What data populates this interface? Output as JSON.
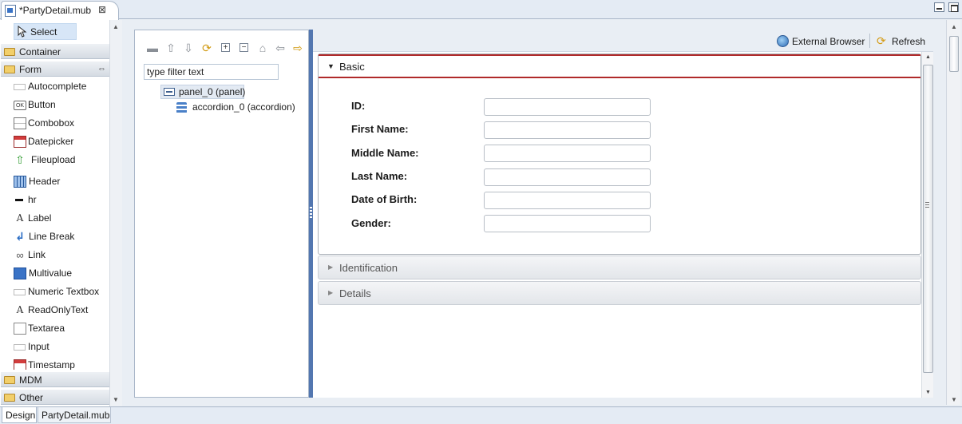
{
  "editor_tab": {
    "title": "*PartyDetail.mub",
    "close_glyph": "⊠",
    "icon": "mub-file-icon"
  },
  "palette": {
    "select_label": "Select",
    "drawers": {
      "container": "Container",
      "form": "Form",
      "mdm": "MDM",
      "other": "Other"
    },
    "form_items": [
      {
        "label": "Autocomplete",
        "icon": "input-box-icon"
      },
      {
        "label": "Button",
        "icon": "ok-button-icon",
        "glyph": "OK"
      },
      {
        "label": "Combobox",
        "icon": "combobox-icon"
      },
      {
        "label": "Datepicker",
        "icon": "calendar-icon"
      },
      {
        "label": "Fileupload",
        "icon": "upload-arrow-icon",
        "glyph": "⇧"
      },
      {
        "label": "Header",
        "icon": "header-grid-icon"
      },
      {
        "label": "hr",
        "icon": "horizontal-rule-icon"
      },
      {
        "label": "Label",
        "icon": "label-a-icon",
        "glyph": "A"
      },
      {
        "label": "Line Break",
        "icon": "line-break-arrow-icon",
        "glyph": "↲"
      },
      {
        "label": "Link",
        "icon": "chain-link-icon",
        "glyph": "∞"
      },
      {
        "label": "Multivalue",
        "icon": "multivalue-url-icon"
      },
      {
        "label": "Numeric Textbox",
        "icon": "input-box-icon"
      },
      {
        "label": "ReadOnlyText",
        "icon": "readonly-a-icon",
        "glyph": "A"
      },
      {
        "label": "Textarea",
        "icon": "textarea-icon"
      },
      {
        "label": "Input",
        "icon": "input-box-icon"
      },
      {
        "label": "Timestamp",
        "icon": "calendar-icon"
      }
    ]
  },
  "bottom_tabs": [
    "Design",
    "PartyDetail.mub"
  ],
  "outline": {
    "toolbar": [
      {
        "name": "remove-icon",
        "glyph": "▬"
      },
      {
        "name": "move-up-icon",
        "glyph": "⇧"
      },
      {
        "name": "move-down-icon",
        "glyph": "⇩"
      },
      {
        "name": "sync-icon",
        "glyph": "⟳"
      },
      {
        "name": "expand-all-icon",
        "glyph": "+"
      },
      {
        "name": "collapse-all-icon",
        "glyph": "−"
      },
      {
        "name": "home-icon",
        "glyph": "⌂"
      },
      {
        "name": "back-icon",
        "glyph": "⇦"
      },
      {
        "name": "forward-icon",
        "glyph": "⇨"
      }
    ],
    "filter_value": "type filter text",
    "tree": [
      {
        "label": "panel_0 (panel)"
      },
      {
        "label": "accordion_0 (accordion)"
      }
    ]
  },
  "preview": {
    "external_browser_label": "External Browser",
    "refresh_label": "Refresh",
    "refresh_glyph": "⟳",
    "accordion": {
      "basic": {
        "title": "Basic",
        "expanded": true,
        "fields": [
          {
            "label": "ID:",
            "value": ""
          },
          {
            "label": "First Name:",
            "value": ""
          },
          {
            "label": "Middle Name:",
            "value": ""
          },
          {
            "label": "Last Name:",
            "value": ""
          },
          {
            "label": "Date of Birth:",
            "value": ""
          },
          {
            "label": "Gender:",
            "value": ""
          }
        ]
      },
      "identification": {
        "title": "Identification",
        "expanded": false
      },
      "details": {
        "title": "Details",
        "expanded": false
      }
    }
  },
  "colors": {
    "accent_red": "#b02a2a",
    "sash_blue": "#5377b0",
    "selection": "#d7e6f7"
  }
}
